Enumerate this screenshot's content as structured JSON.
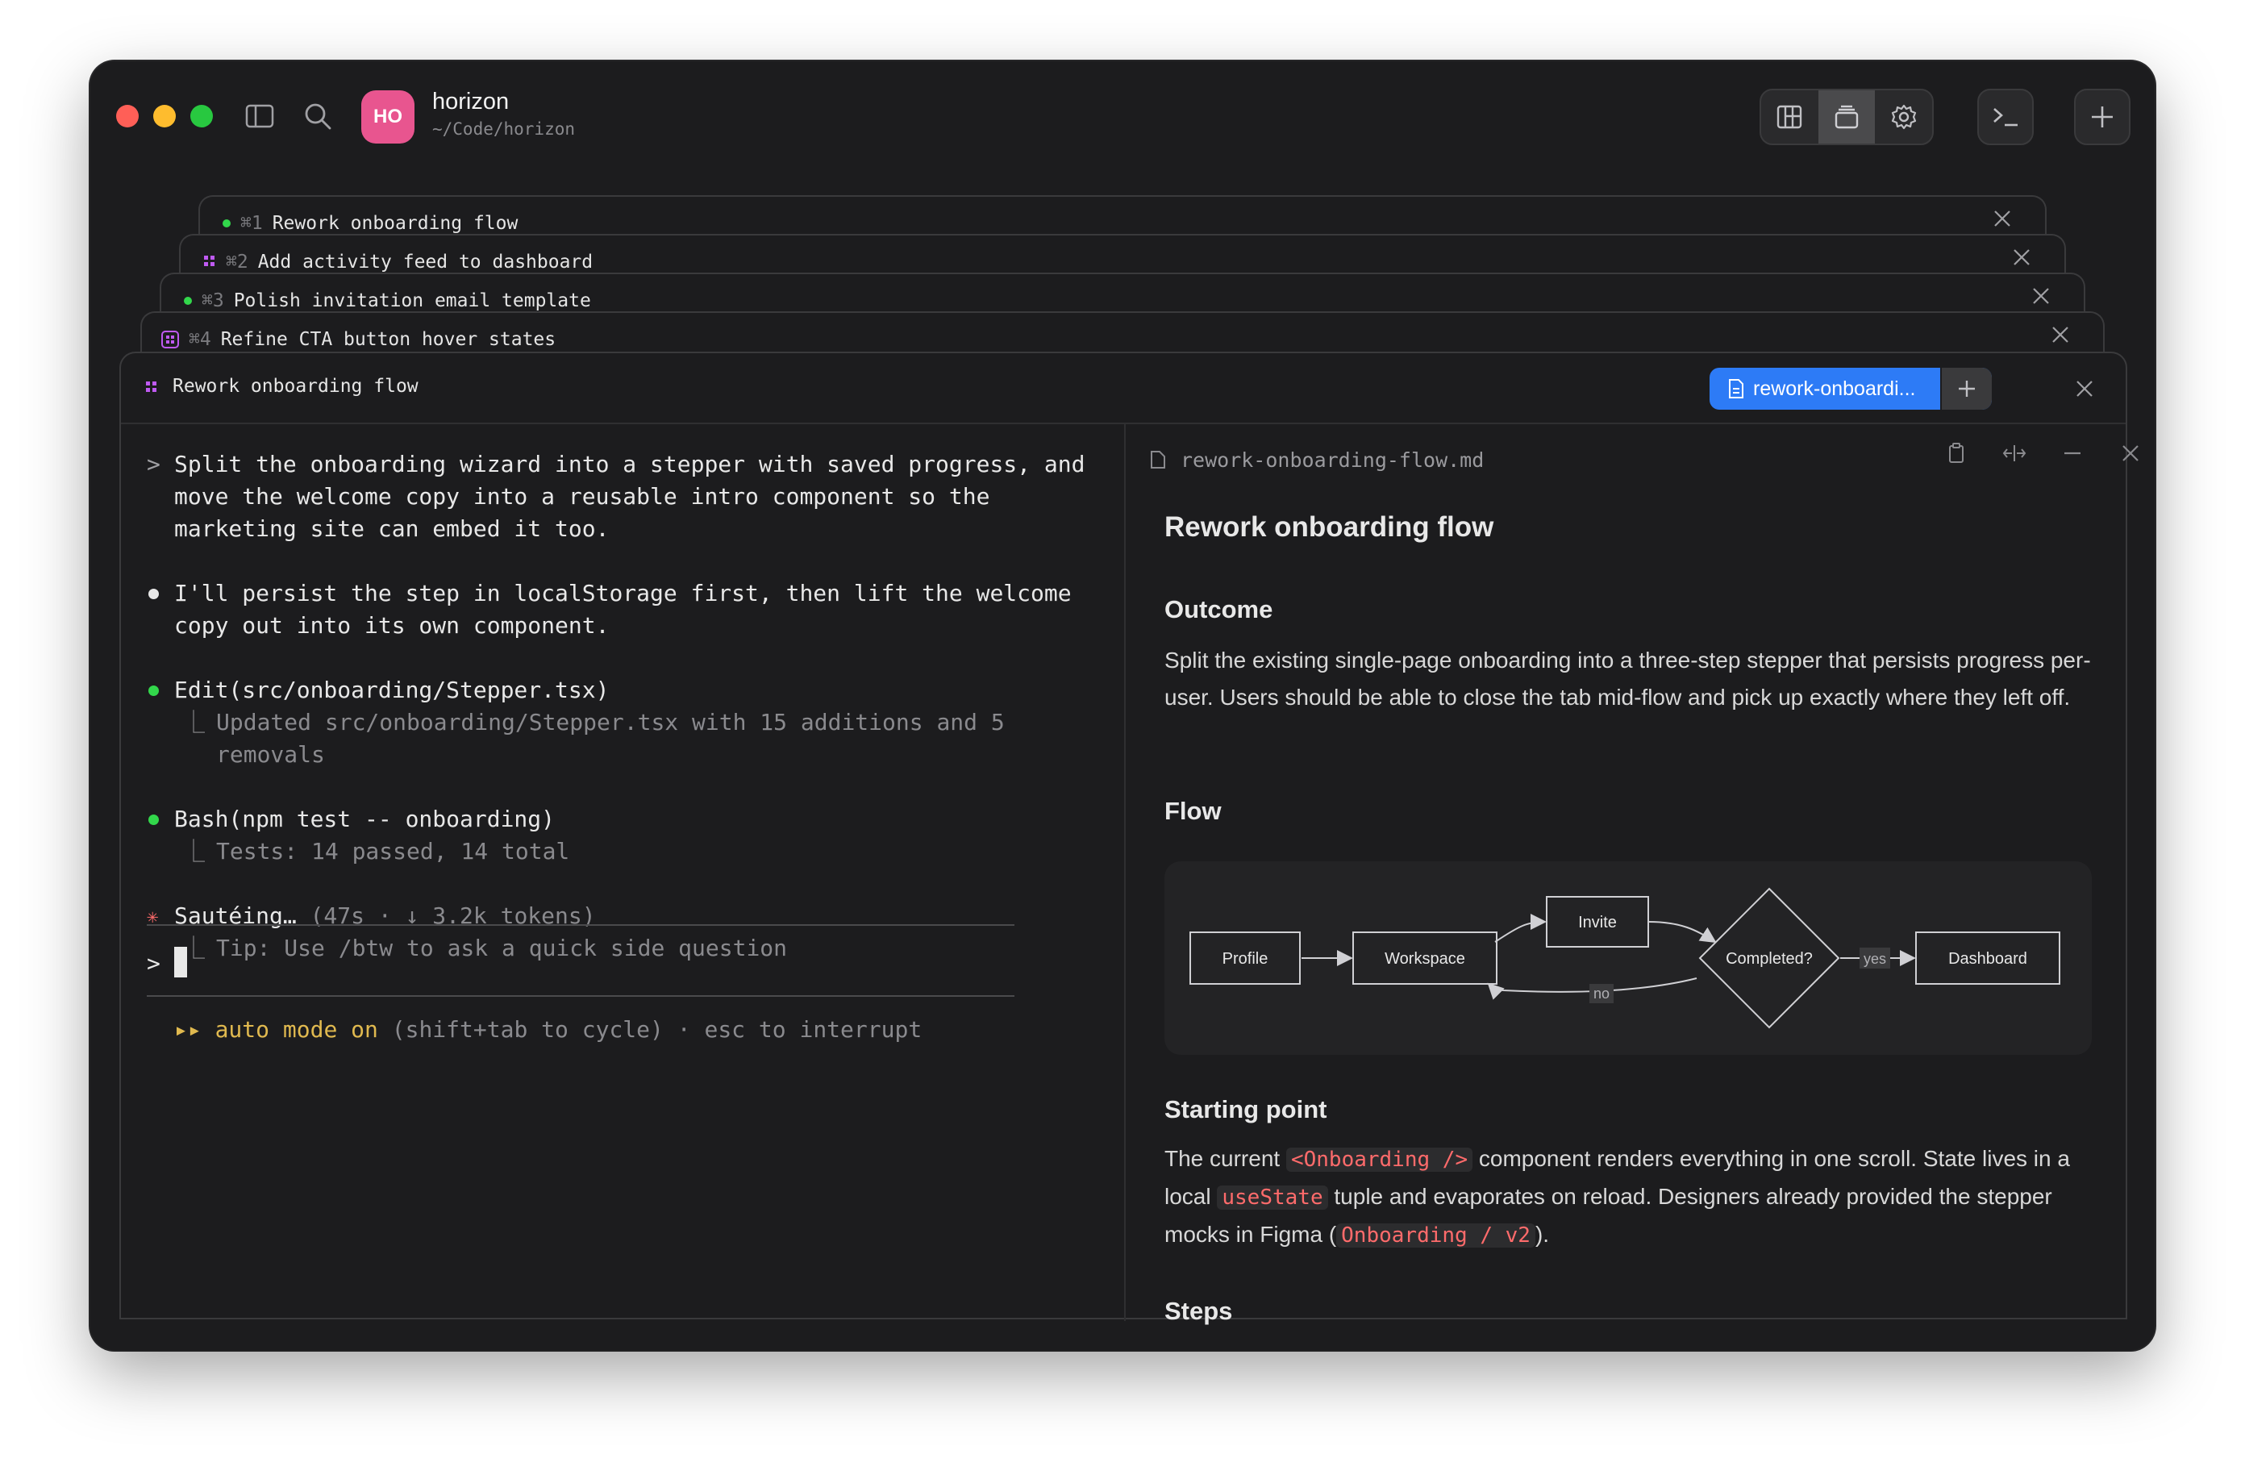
{
  "titlebar": {
    "avatar_initials": "HO",
    "project_name": "horizon",
    "project_path": "~/Code/horizon",
    "avatar_color": "#e8558f"
  },
  "stacked_tabs": [
    {
      "shortcut": "⌘1",
      "label": "Rework onboarding flow",
      "status": "green-dot"
    },
    {
      "shortcut": "⌘2",
      "label": "Add activity feed to dashboard",
      "status": "grid-icon"
    },
    {
      "shortcut": "⌘3",
      "label": "Polish invitation email template",
      "status": "green-dot"
    },
    {
      "shortcut": "⌘4",
      "label": "Refine CTA button hover states",
      "status": "grid-icon"
    }
  ],
  "panel": {
    "title": "Rework onboarding flow",
    "file_tab": "rework-onboardi...",
    "accent": "#2d7bf6"
  },
  "terminal": {
    "prompt_marker": ">",
    "user_message": "Split the onboarding wizard into a stepper with saved progress, and move the welcome copy into a reusable intro component so the marketing site can embed it too.",
    "assistant_message": "I'll persist the step in localStorage first, then lift the welcome copy out into its own component.",
    "tool1_title": "Edit(src/onboarding/Stepper.tsx)",
    "tool1_result": "Updated src/onboarding/Stepper.tsx with 15 additions and 5 removals",
    "tool2_title": "Bash(npm test -- onboarding)",
    "tool2_result": "Tests: 14 passed, 14 total",
    "status_marker": "✳",
    "status_verb": "Sautéing…",
    "status_meta": "(47s · ↓ 3.2k tokens)",
    "tip": "Tip: Use /btw to ask a quick side question",
    "input_prompt": ">",
    "auto_mode_arrows": "▸▸",
    "auto_mode_label": "auto mode on",
    "auto_mode_hint": "(shift+tab to cycle) · esc to interrupt",
    "auto_mode_color": "#e0b94f",
    "status_color": "#ff6b6b",
    "corner_glyph": "⎿"
  },
  "markdown": {
    "filename": "rework-onboarding-flow.md",
    "title": "Rework onboarding flow",
    "outcome_heading": "Outcome",
    "outcome_text": "Split the existing single-page onboarding into a three-step stepper that persists progress per-user. Users should be able to close the tab mid-flow and pick up exactly where they left off.",
    "flow_heading": "Flow",
    "flow_nodes": {
      "profile": "Profile",
      "workspace": "Workspace",
      "invite": "Invite",
      "completed": "Completed?",
      "dashboard": "Dashboard",
      "yes": "yes",
      "no": "no"
    },
    "starting_heading": "Starting point",
    "starting_p1": "The current",
    "starting_code1": "<Onboarding />",
    "starting_p2": "component renders everything in one scroll. State lives in",
    "starting_p3": "a local",
    "starting_code2": "useState",
    "starting_p4": "tuple and evaporates on reload. Designers already provided the",
    "starting_p5": "stepper mocks in Figma (",
    "starting_code3": "Onboarding / v2",
    "starting_p6": ").",
    "steps_heading": "Steps"
  }
}
